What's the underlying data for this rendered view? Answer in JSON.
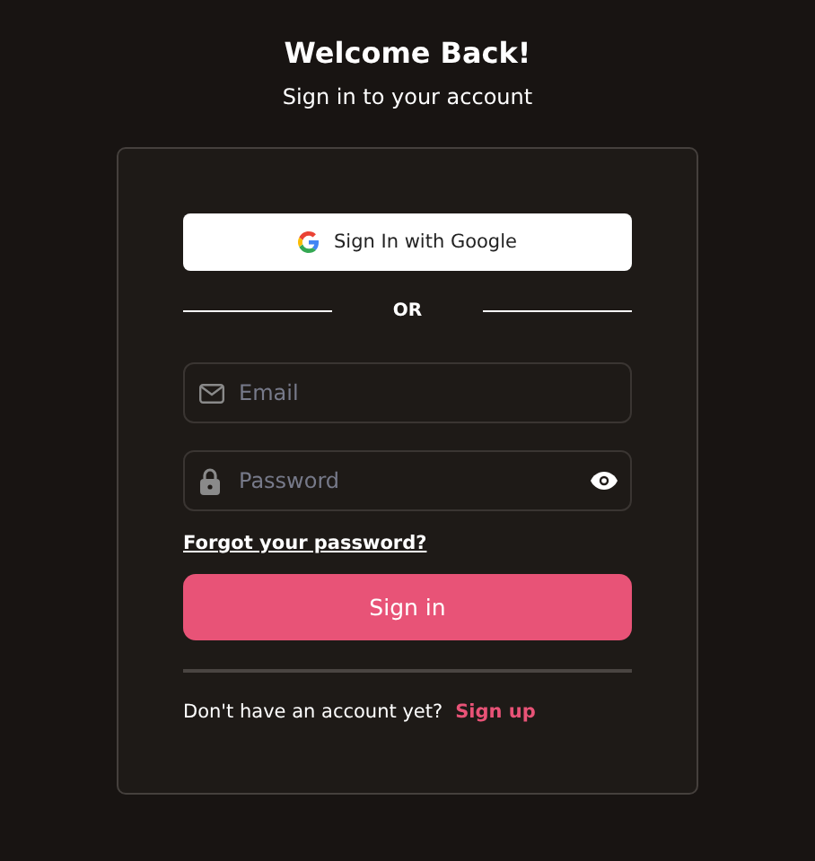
{
  "header": {
    "title": "Welcome Back!",
    "subtitle": "Sign in to your account"
  },
  "google_button": "Sign In with Google",
  "divider_text": "OR",
  "fields": [
    {
      "kind": "email",
      "placeholder": "Email"
    },
    {
      "kind": "password",
      "placeholder": "Password"
    }
  ],
  "forgot_link": "Forgot your password?",
  "submit_button": "Sign in",
  "footer": {
    "text": "Don't have an account yet?",
    "link": "Sign up"
  }
}
